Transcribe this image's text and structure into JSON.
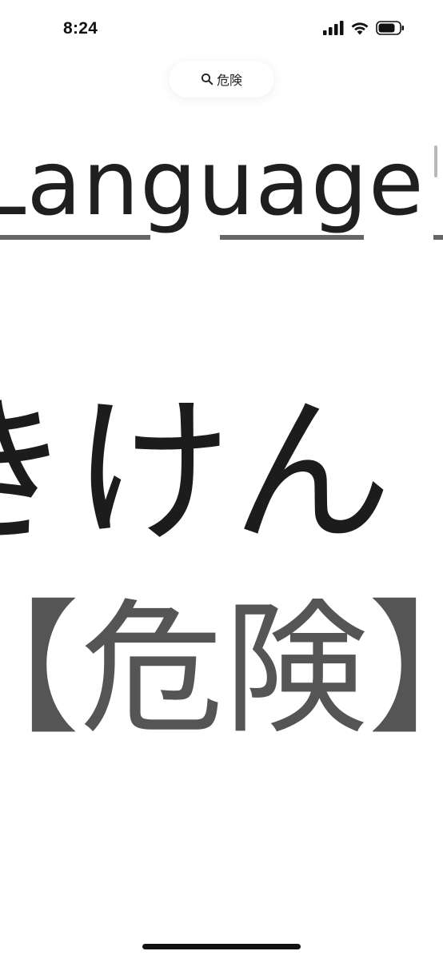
{
  "status_bar": {
    "time": "8:24",
    "signal_icon": "cellular-signal-icon",
    "wifi_icon": "wifi-icon",
    "battery_icon": "battery-icon"
  },
  "search": {
    "icon": "search-icon",
    "query": "危険"
  },
  "content": {
    "heading": "Language",
    "reading": "きけん",
    "kanji": "【危険】"
  },
  "colors": {
    "background": "#ffffff",
    "heading_text": "#1f1f1f",
    "underline": "#666666",
    "kanji_text": "#555555",
    "scrollbar": "#b8b8b8"
  }
}
